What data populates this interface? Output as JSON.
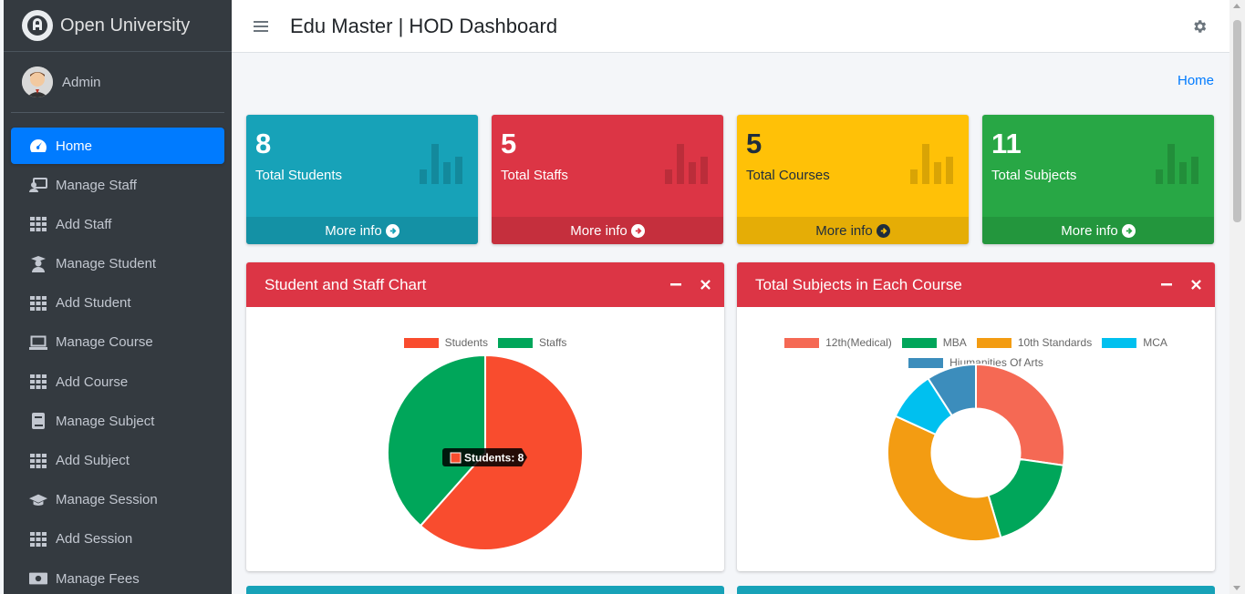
{
  "brand": {
    "name": "Open University"
  },
  "user": {
    "name": "Admin"
  },
  "nav": [
    {
      "label": "Home",
      "icon": "tachometer-icon",
      "active": true
    },
    {
      "label": "Manage Staff",
      "icon": "chalkboard-teacher-icon"
    },
    {
      "label": "Add Staff",
      "icon": "grid-icon"
    },
    {
      "label": "Manage Student",
      "icon": "user-graduate-icon"
    },
    {
      "label": "Add Student",
      "icon": "grid-icon"
    },
    {
      "label": "Manage Course",
      "icon": "laptop-icon"
    },
    {
      "label": "Add Course",
      "icon": "grid-icon"
    },
    {
      "label": "Manage Subject",
      "icon": "book-icon"
    },
    {
      "label": "Add Subject",
      "icon": "grid-icon"
    },
    {
      "label": "Manage Session",
      "icon": "graduation-cap-icon"
    },
    {
      "label": "Add Session",
      "icon": "grid-icon"
    },
    {
      "label": "Manage Fees",
      "icon": "money-icon"
    }
  ],
  "header": {
    "title": "Edu Master | HOD Dashboard"
  },
  "breadcrumb": {
    "home": "Home"
  },
  "stats": [
    {
      "value": "8",
      "label": "Total Students",
      "more": "More info",
      "color": "#17a2b8"
    },
    {
      "value": "5",
      "label": "Total Staffs",
      "more": "More info",
      "color": "#dc3545"
    },
    {
      "value": "5",
      "label": "Total Courses",
      "more": "More info",
      "color": "#ffc107"
    },
    {
      "value": "11",
      "label": "Total Subjects",
      "more": "More info",
      "color": "#28a745"
    }
  ],
  "cards": {
    "left_title": "Student and Staff Chart",
    "right_title": "Total Subjects in Each Course"
  },
  "chart_data": [
    {
      "type": "pie",
      "title": "Student and Staff Chart",
      "categories": [
        "Students",
        "Staffs"
      ],
      "values": [
        8,
        5
      ],
      "colors": [
        "#f94c2e",
        "#00a65a"
      ],
      "legend": "top",
      "tooltip": "Students: 8"
    },
    {
      "type": "pie",
      "variant": "doughnut",
      "title": "Total Subjects in Each Course",
      "categories": [
        "12th(Medical)",
        "MBA",
        "10th Standards",
        "MCA",
        "Hiumanities Of Arts"
      ],
      "values": [
        3,
        2,
        4,
        1,
        1
      ],
      "colors": [
        "#f56954",
        "#00a65a",
        "#f39c12",
        "#00c0ef",
        "#3c8dbc"
      ],
      "legend": "top"
    }
  ]
}
